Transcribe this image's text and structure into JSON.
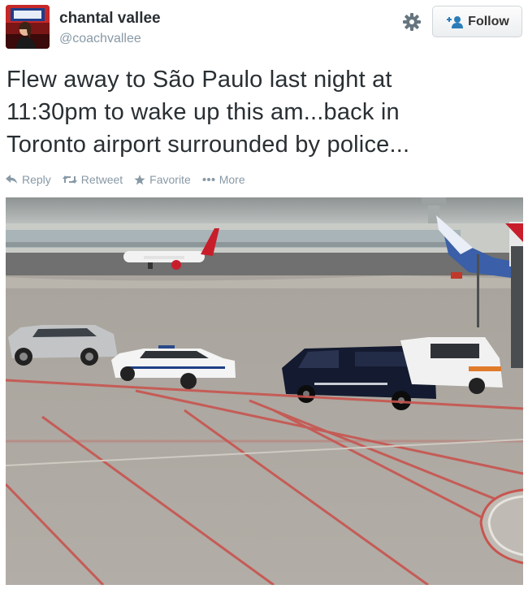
{
  "user": {
    "name": "chantal vallee",
    "handle": "@coachvallee"
  },
  "follow": {
    "label": "Follow"
  },
  "tweet": {
    "lines": [
      "Flew away to São Paulo last night at",
      "11:30pm to wake up this am...back in",
      "Toronto airport surrounded by police..."
    ]
  },
  "actions": {
    "reply": "Reply",
    "retweet": "Retweet",
    "favorite": "Favorite",
    "more": "More"
  },
  "icons": {
    "avatar": "avatar",
    "settings": "gear-icon",
    "follow": "add-user-icon",
    "reply": "reply-icon",
    "retweet": "retweet-icon",
    "favorite": "star-icon",
    "more": "more-dots-icon"
  },
  "colors": {
    "link": "#8899a6",
    "follow_accent": "#2b7bb9",
    "text": "#292f33"
  }
}
